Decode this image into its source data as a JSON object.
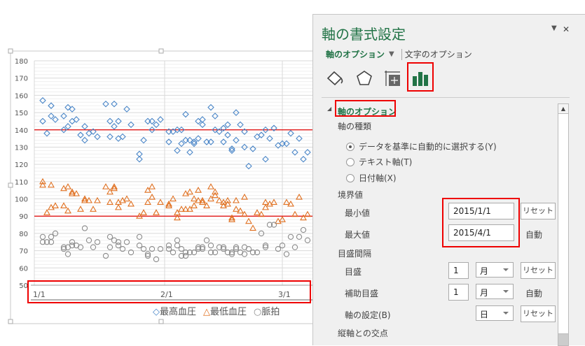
{
  "chart_data": {
    "type": "scatter",
    "x_unit": "day offset from 2015/1/1",
    "xlim_dates": [
      "2015/1/1",
      "2015/4/1"
    ],
    "ylim": [
      50,
      180
    ],
    "yticks": [
      "50",
      "60",
      "70",
      "80",
      "90",
      "100",
      "110",
      "120",
      "130",
      "140",
      "150",
      "160",
      "170",
      "180"
    ],
    "xticks": [
      {
        "day": 0,
        "label": "1/1"
      },
      {
        "day": 31,
        "label": "2/1"
      },
      {
        "day": 59,
        "label": "3/1"
      }
    ],
    "reference_lines": [
      {
        "value": 140,
        "color": "#e00000"
      },
      {
        "value": 90,
        "color": "#e00000"
      }
    ],
    "grid": true,
    "legend_position": "bottom",
    "series": [
      {
        "name": "最高血圧",
        "marker": "diamond",
        "color": "#4a86c8",
        "points": [
          [
            2,
            157
          ],
          [
            2,
            145
          ],
          [
            3,
            138
          ],
          [
            4,
            154
          ],
          [
            4,
            148
          ],
          [
            5,
            146
          ],
          [
            7,
            148
          ],
          [
            7,
            140
          ],
          [
            8,
            153
          ],
          [
            8,
            142
          ],
          [
            9,
            152
          ],
          [
            9,
            145
          ],
          [
            10,
            146
          ],
          [
            11,
            137
          ],
          [
            12,
            142
          ],
          [
            12,
            134
          ],
          [
            13,
            138
          ],
          [
            14,
            139
          ],
          [
            15,
            136
          ],
          [
            17,
            155
          ],
          [
            18,
            145
          ],
          [
            18,
            136
          ],
          [
            19,
            155
          ],
          [
            19,
            142
          ],
          [
            20,
            145
          ],
          [
            20,
            135
          ],
          [
            21,
            136
          ],
          [
            22,
            152
          ],
          [
            23,
            143
          ],
          [
            25,
            126
          ],
          [
            25,
            123
          ],
          [
            26,
            134
          ],
          [
            27,
            145
          ],
          [
            28,
            145
          ],
          [
            28,
            140
          ],
          [
            29,
            143
          ],
          [
            30,
            146
          ],
          [
            32,
            139
          ],
          [
            32,
            133
          ],
          [
            33,
            139
          ],
          [
            34,
            140
          ],
          [
            34,
            128
          ],
          [
            35,
            140
          ],
          [
            35,
            132
          ],
          [
            36,
            149
          ],
          [
            36,
            134
          ],
          [
            37,
            134
          ],
          [
            37,
            127
          ],
          [
            38,
            133
          ],
          [
            38,
            132
          ],
          [
            39,
            145
          ],
          [
            39,
            135
          ],
          [
            40,
            146
          ],
          [
            40,
            143
          ],
          [
            41,
            133
          ],
          [
            42,
            153
          ],
          [
            42,
            133
          ],
          [
            43,
            148
          ],
          [
            43,
            140
          ],
          [
            44,
            139
          ],
          [
            45,
            141
          ],
          [
            45,
            133
          ],
          [
            46,
            143
          ],
          [
            46,
            137
          ],
          [
            47,
            128
          ],
          [
            47,
            129
          ],
          [
            48,
            150
          ],
          [
            48,
            134
          ],
          [
            49,
            143
          ],
          [
            50,
            139
          ],
          [
            50,
            130
          ],
          [
            51,
            119
          ],
          [
            52,
            129
          ],
          [
            53,
            136
          ],
          [
            54,
            137
          ],
          [
            55,
            140
          ],
          [
            55,
            123
          ],
          [
            56,
            135
          ],
          [
            57,
            141
          ],
          [
            58,
            131
          ],
          [
            59,
            132
          ],
          [
            60,
            132
          ],
          [
            61,
            138
          ],
          [
            62,
            127
          ],
          [
            63,
            135
          ],
          [
            64,
            123
          ],
          [
            65,
            127
          ]
        ]
      },
      {
        "name": "最低血圧",
        "marker": "triangle",
        "color": "#e07020",
        "points": [
          [
            2,
            110
          ],
          [
            2,
            108
          ],
          [
            3,
            92
          ],
          [
            4,
            108
          ],
          [
            4,
            95
          ],
          [
            5,
            96
          ],
          [
            7,
            106
          ],
          [
            7,
            96
          ],
          [
            8,
            107
          ],
          [
            8,
            93
          ],
          [
            9,
            104
          ],
          [
            9,
            103
          ],
          [
            10,
            103
          ],
          [
            11,
            94
          ],
          [
            12,
            100
          ],
          [
            12,
            99
          ],
          [
            13,
            99
          ],
          [
            14,
            94
          ],
          [
            15,
            99
          ],
          [
            17,
            107
          ],
          [
            18,
            104
          ],
          [
            18,
            98
          ],
          [
            19,
            107
          ],
          [
            19,
            106
          ],
          [
            20,
            98
          ],
          [
            20,
            95
          ],
          [
            21,
            99
          ],
          [
            22,
            100
          ],
          [
            23,
            97
          ],
          [
            25,
            90
          ],
          [
            26,
            92
          ],
          [
            27,
            105
          ],
          [
            27,
            98
          ],
          [
            28,
            107
          ],
          [
            28,
            101
          ],
          [
            29,
            92
          ],
          [
            30,
            98
          ],
          [
            32,
            97
          ],
          [
            32,
            96
          ],
          [
            33,
            100
          ],
          [
            34,
            92
          ],
          [
            34,
            89
          ],
          [
            35,
            94
          ],
          [
            36,
            103
          ],
          [
            36,
            94
          ],
          [
            37,
            104
          ],
          [
            37,
            94
          ],
          [
            38,
            100
          ],
          [
            38,
            96
          ],
          [
            39,
            105
          ],
          [
            39,
            99
          ],
          [
            40,
            99
          ],
          [
            40,
            98
          ],
          [
            41,
            96
          ],
          [
            42,
            107
          ],
          [
            42,
            100
          ],
          [
            43,
            104
          ],
          [
            43,
            102
          ],
          [
            44,
            99
          ],
          [
            45,
            98
          ],
          [
            45,
            96
          ],
          [
            46,
            99
          ],
          [
            46,
            97
          ],
          [
            47,
            89
          ],
          [
            47,
            88
          ],
          [
            48,
            99
          ],
          [
            48,
            94
          ],
          [
            49,
            93
          ],
          [
            50,
            101
          ],
          [
            50,
            91
          ],
          [
            51,
            87
          ],
          [
            52,
            83
          ],
          [
            53,
            92
          ],
          [
            54,
            91
          ],
          [
            55,
            98
          ],
          [
            55,
            95
          ],
          [
            56,
            97
          ],
          [
            57,
            98
          ],
          [
            58,
            87
          ],
          [
            59,
            88
          ],
          [
            60,
            98
          ],
          [
            61,
            97
          ],
          [
            62,
            91
          ],
          [
            63,
            101
          ],
          [
            64,
            89
          ],
          [
            65,
            91
          ]
        ]
      },
      {
        "name": "脈拍",
        "marker": "circle",
        "color": "#8c8c8c",
        "points": [
          [
            2,
            78
          ],
          [
            2,
            75
          ],
          [
            3,
            75
          ],
          [
            4,
            78
          ],
          [
            4,
            75
          ],
          [
            5,
            80
          ],
          [
            7,
            72
          ],
          [
            7,
            71
          ],
          [
            8,
            72
          ],
          [
            8,
            68
          ],
          [
            9,
            75
          ],
          [
            9,
            73
          ],
          [
            10,
            73
          ],
          [
            11,
            72
          ],
          [
            12,
            83
          ],
          [
            13,
            76
          ],
          [
            14,
            72
          ],
          [
            15,
            75
          ],
          [
            17,
            67
          ],
          [
            18,
            78
          ],
          [
            18,
            72
          ],
          [
            19,
            76
          ],
          [
            20,
            75
          ],
          [
            20,
            73
          ],
          [
            21,
            71
          ],
          [
            22,
            75
          ],
          [
            23,
            69
          ],
          [
            25,
            78
          ],
          [
            25,
            73
          ],
          [
            26,
            71
          ],
          [
            27,
            68
          ],
          [
            27,
            67
          ],
          [
            28,
            71
          ],
          [
            29,
            65
          ],
          [
            30,
            71
          ],
          [
            32,
            73
          ],
          [
            32,
            71
          ],
          [
            33,
            69
          ],
          [
            34,
            76
          ],
          [
            34,
            73
          ],
          [
            35,
            71
          ],
          [
            35,
            67
          ],
          [
            36,
            69
          ],
          [
            36,
            67
          ],
          [
            37,
            69
          ],
          [
            38,
            69
          ],
          [
            39,
            72
          ],
          [
            39,
            71
          ],
          [
            40,
            72
          ],
          [
            40,
            71
          ],
          [
            41,
            76
          ],
          [
            42,
            73
          ],
          [
            42,
            69
          ],
          [
            43,
            69
          ],
          [
            44,
            72
          ],
          [
            45,
            72
          ],
          [
            45,
            71
          ],
          [
            46,
            69
          ],
          [
            47,
            69
          ],
          [
            47,
            68
          ],
          [
            48,
            72
          ],
          [
            48,
            71
          ],
          [
            49,
            69
          ],
          [
            50,
            72
          ],
          [
            50,
            68
          ],
          [
            51,
            71
          ],
          [
            52,
            69
          ],
          [
            53,
            69
          ],
          [
            54,
            80
          ],
          [
            55,
            73
          ],
          [
            55,
            72
          ],
          [
            56,
            85
          ],
          [
            57,
            85
          ],
          [
            58,
            71
          ],
          [
            59,
            73
          ],
          [
            60,
            68
          ],
          [
            61,
            78
          ],
          [
            62,
            72
          ],
          [
            63,
            78
          ],
          [
            64,
            82
          ],
          [
            65,
            76
          ]
        ]
      }
    ]
  },
  "panel": {
    "title": "軸の書式設定",
    "dropdown_glyph": "▼",
    "close_glyph": "✕",
    "tab_axis_options": "軸のオプション",
    "tab_text_options": "文字のオプション",
    "section_title": "軸のオプション",
    "axis_type_label": "軸の種類",
    "radio_auto": "データを基準に自動的に選択する(Y)",
    "radio_text": "テキスト軸(T)",
    "radio_date": "日付軸(X)",
    "bounds_label": "境界値",
    "min_label": "最小値",
    "min_value": "2015/1/1",
    "max_label": "最大値",
    "max_value": "2015/4/1",
    "reset": "リセット",
    "auto": "自動",
    "units_label": "目盛間隔",
    "major_label": "目盛",
    "major_value": "1",
    "major_unit": "月",
    "minor_label": "補助目盛",
    "minor_value": "1",
    "minor_unit": "月",
    "base_label": "軸の設定(B)",
    "base_unit": "日",
    "cross_label": "縦軸との交点"
  },
  "colors": {
    "accent": "#217346",
    "highlight": "#e00000"
  }
}
